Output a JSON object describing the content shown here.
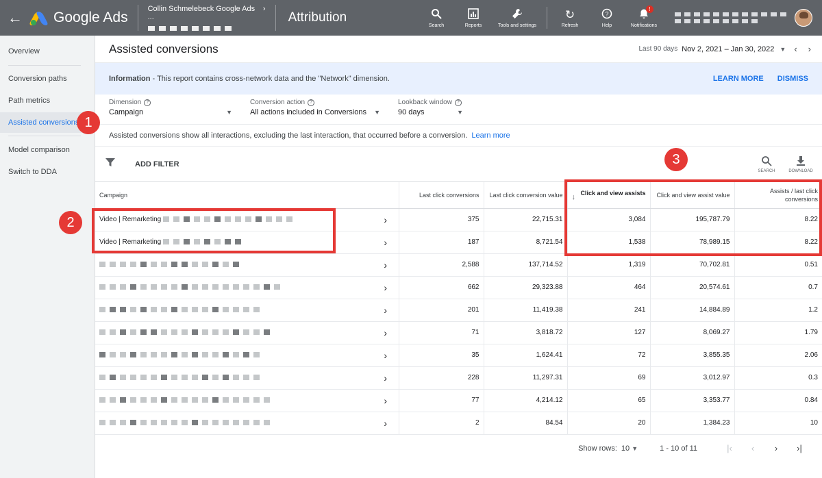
{
  "topbar": {
    "product": "Google Ads",
    "account_name": "Collin Schmelebeck Google Ads ...",
    "page": "Attribution",
    "tools": [
      {
        "icon": "search-icon",
        "label": "Search"
      },
      {
        "icon": "reports-icon",
        "label": "Reports"
      },
      {
        "icon": "wrench-icon",
        "label": "Tools and settings"
      },
      {
        "icon": "refresh-icon",
        "label": "Refresh"
      },
      {
        "icon": "help-icon",
        "label": "Help"
      },
      {
        "icon": "bell-icon",
        "label": "Notifications"
      }
    ],
    "notification_badge": "!"
  },
  "sidebar": {
    "items": [
      {
        "label": "Overview"
      },
      {
        "label": "Conversion paths"
      },
      {
        "label": "Path metrics"
      },
      {
        "label": "Assisted conversions"
      },
      {
        "label": "Model comparison"
      },
      {
        "label": "Switch to DDA"
      }
    ]
  },
  "header": {
    "title": "Assisted conversions",
    "range_label": "Last 90 days",
    "range_value": "Nov 2, 2021 – Jan 30, 2022"
  },
  "info": {
    "lead": "Information",
    "text": " - This report contains cross-network data and the \"Network\" dimension.",
    "learn_more": "LEARN MORE",
    "dismiss": "DISMISS"
  },
  "dimensions": {
    "dimension": {
      "label": "Dimension",
      "value": "Campaign"
    },
    "conversion_action": {
      "label": "Conversion action",
      "value": "All actions included in Conversions"
    },
    "lookback": {
      "label": "Lookback window",
      "value": "90 days"
    }
  },
  "explain": {
    "text": "Assisted conversions show all interactions, excluding the last interaction, that occurred before a conversion.",
    "link": "Learn more"
  },
  "filter": {
    "add_filter": "ADD FILTER",
    "search": "SEARCH",
    "download": "DOWNLOAD"
  },
  "table": {
    "headers": {
      "campaign": "Campaign",
      "last_click_conversions": "Last click conversions",
      "last_click_value": "Last click conversion value",
      "click_view_assists": "Click and view assists",
      "click_view_assist_value": "Click and view assist value",
      "assists_ratio": "Assists / last click conversions"
    },
    "rows": [
      {
        "campaign": "Video | Remarketing",
        "last_click_conversions": "375",
        "last_click_value": "22,715.31",
        "assists": "3,084",
        "assist_value": "195,787.79",
        "ratio": "8.22"
      },
      {
        "campaign": "Video | Remarketing",
        "last_click_conversions": "187",
        "last_click_value": "8,721.54",
        "assists": "1,538",
        "assist_value": "78,989.15",
        "ratio": "8.22"
      },
      {
        "campaign": "",
        "last_click_conversions": "2,588",
        "last_click_value": "137,714.52",
        "assists": "1,319",
        "assist_value": "70,702.81",
        "ratio": "0.51"
      },
      {
        "campaign": "",
        "last_click_conversions": "662",
        "last_click_value": "29,323.88",
        "assists": "464",
        "assist_value": "20,574.61",
        "ratio": "0.7"
      },
      {
        "campaign": "",
        "last_click_conversions": "201",
        "last_click_value": "11,419.38",
        "assists": "241",
        "assist_value": "14,884.89",
        "ratio": "1.2"
      },
      {
        "campaign": "",
        "last_click_conversions": "71",
        "last_click_value": "3,818.72",
        "assists": "127",
        "assist_value": "8,069.27",
        "ratio": "1.79"
      },
      {
        "campaign": "",
        "last_click_conversions": "35",
        "last_click_value": "1,624.41",
        "assists": "72",
        "assist_value": "3,855.35",
        "ratio": "2.06"
      },
      {
        "campaign": "",
        "last_click_conversions": "228",
        "last_click_value": "11,297.31",
        "assists": "69",
        "assist_value": "3,012.97",
        "ratio": "0.3"
      },
      {
        "campaign": "",
        "last_click_conversions": "77",
        "last_click_value": "4,214.12",
        "assists": "65",
        "assist_value": "3,353.77",
        "ratio": "0.84"
      },
      {
        "campaign": "",
        "last_click_conversions": "2",
        "last_click_value": "84.54",
        "assists": "20",
        "assist_value": "1,384.23",
        "ratio": "10"
      }
    ]
  },
  "pager": {
    "show_rows_label": "Show rows:",
    "rows_value": "10",
    "range": "1 - 10 of 11"
  },
  "annotations": [
    "1",
    "2",
    "3"
  ],
  "colors": {
    "accent": "#1a73e8",
    "annotation": "#e53935",
    "topbar": "#5f6368"
  }
}
